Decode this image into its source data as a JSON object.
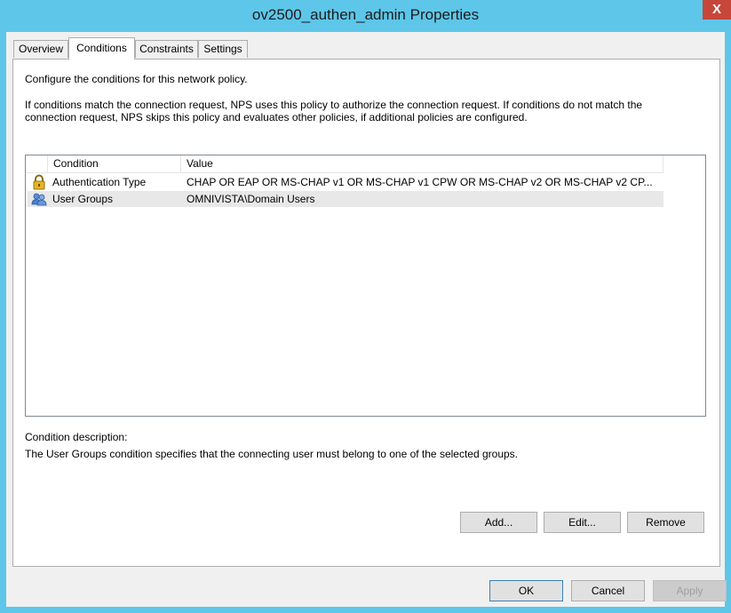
{
  "window": {
    "title": "ov2500_authen_admin Properties",
    "close_glyph": "X"
  },
  "tabs": [
    {
      "label": "Overview",
      "active": false
    },
    {
      "label": "Conditions",
      "active": true
    },
    {
      "label": "Constraints",
      "active": false
    },
    {
      "label": "Settings",
      "active": false
    }
  ],
  "panel": {
    "intro": "Configure the conditions for this network policy.",
    "explanation_line1": "If conditions match the connection request, NPS uses this policy to authorize the connection request. If conditions do not match the",
    "explanation_line2": "connection request, NPS skips this policy and evaluates other policies, if additional policies are configured."
  },
  "conditions_list": {
    "columns": [
      "Condition",
      "Value"
    ],
    "rows": [
      {
        "icon": "padlock-icon",
        "condition": "Authentication Type",
        "value": "CHAP OR EAP OR MS-CHAP v1 OR MS-CHAP v1 CPW OR MS-CHAP v2 OR MS-CHAP v2 CP..."
      },
      {
        "icon": "user-group-icon",
        "condition": "User Groups",
        "value": "OMNIVISTA\\Domain Users",
        "selected": true
      }
    ]
  },
  "description": {
    "label": "Condition description:",
    "text": "The User Groups condition specifies that the connecting user must belong to one of the selected groups."
  },
  "panel_buttons": {
    "add": "Add...",
    "edit": "Edit...",
    "remove": "Remove"
  },
  "dialog_buttons": {
    "ok": "OK",
    "cancel": "Cancel",
    "apply": "Apply"
  },
  "colors": {
    "titlebar": "#5ec6e8",
    "close": "#c7463a",
    "selected_row": "#e8e8e8"
  }
}
